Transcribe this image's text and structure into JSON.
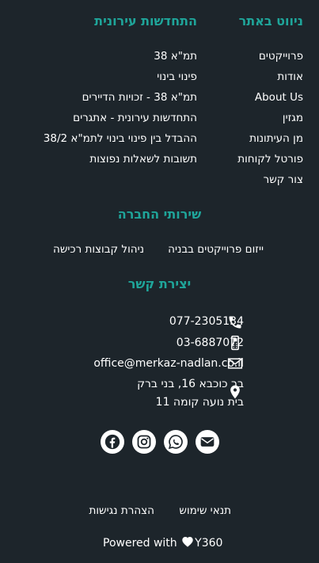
{
  "nav": {
    "heading": "ניווט באתר",
    "items": [
      "פרוייקטים",
      "אודות",
      "About Us",
      "מגזין",
      "מן העיתונות",
      "פורטל לקוחות",
      "צור קשר"
    ]
  },
  "news": {
    "heading": "התחדשות עירונית",
    "items": [
      "תמ\"א 38",
      "פינוי בינוי",
      "תמ\"א 38 - זכויות הדיירים",
      "התחדשות עירונית - אתגרים",
      "ההבדל בין פינוי בינוי לתמ\"א 38/2",
      "תשובות לשאלות נפוצות"
    ]
  },
  "services": {
    "heading": "שירותי החברה",
    "items": [
      "ייזום פרוייקטים בבניה",
      "ניהול קבוצות רכישה"
    ]
  },
  "contact": {
    "heading": "יצירת קשר",
    "phone": "077-2305134",
    "mobile": "03-6887072",
    "email": "office@merkaz-nadlan.co.il",
    "address_line1": "בר כוכבא 16, בני ברק",
    "address_line2": "בית נועה קומה 11"
  },
  "social": [
    "facebook-icon",
    "instagram-icon",
    "whatsapp-icon",
    "email-icon"
  ],
  "footer": {
    "terms": "תנאי שימוש",
    "accessibility": "הצהרת נגישות",
    "powered_prefix": "Powered with",
    "powered_brand": "Y360"
  },
  "colors": {
    "background": "#1d252b",
    "accent": "#1fa59a",
    "text": "#ffffff"
  }
}
